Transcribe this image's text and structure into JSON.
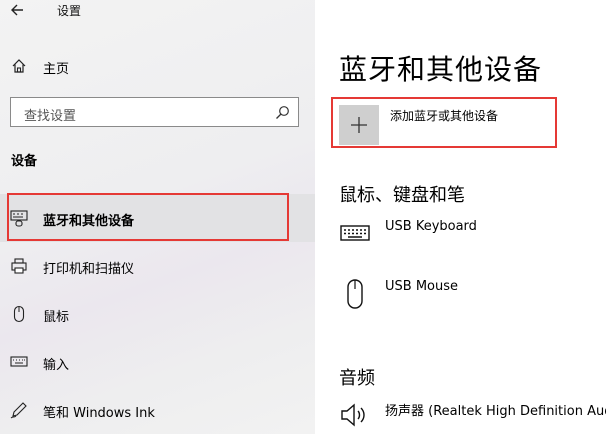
{
  "window": {
    "title": "设置"
  },
  "sidebar": {
    "home_label": "主页",
    "search_placeholder": "查找设置",
    "section_title": "设备",
    "items": [
      {
        "label": "蓝牙和其他设备",
        "icon": "bluetooth-devices-icon",
        "active": true
      },
      {
        "label": "打印机和扫描仪",
        "icon": "printer-icon"
      },
      {
        "label": "鼠标",
        "icon": "mouse-icon"
      },
      {
        "label": "输入",
        "icon": "keyboard-icon"
      },
      {
        "label": "笔和 Windows Ink",
        "icon": "pen-icon"
      }
    ]
  },
  "main": {
    "title": "蓝牙和其他设备",
    "add_device_label": "添加蓝牙或其他设备",
    "groups": [
      {
        "title": "鼠标、键盘和笔",
        "devices": [
          {
            "name": "USB Keyboard",
            "icon": "keyboard-icon"
          },
          {
            "name": "USB Mouse",
            "icon": "mouse-icon"
          }
        ]
      },
      {
        "title": "音频",
        "devices": [
          {
            "name": "扬声器 (Realtek High Definition Audio)",
            "icon": "speaker-icon"
          }
        ]
      }
    ]
  },
  "colors": {
    "highlight_border": "#e53935",
    "active_item_bg": "#e2e2e4",
    "add_tile_bg": "#cfcfcf"
  }
}
